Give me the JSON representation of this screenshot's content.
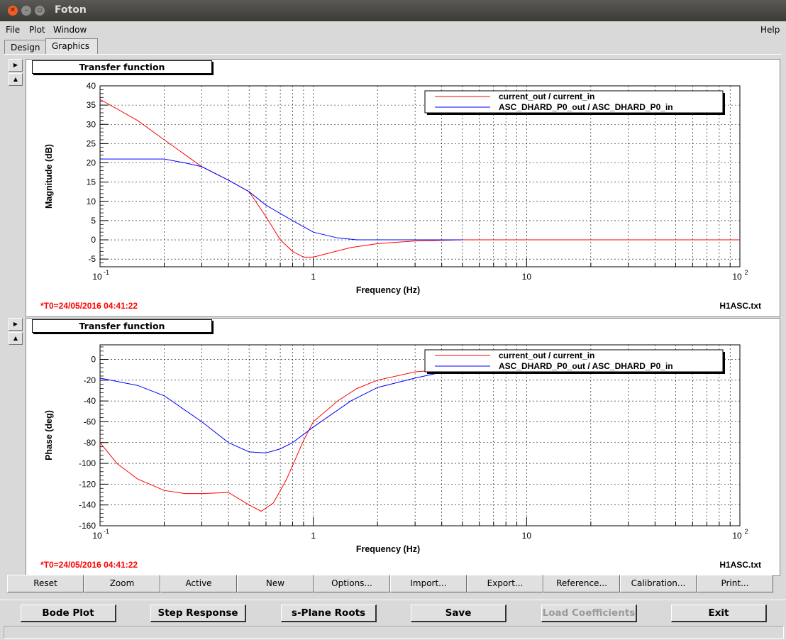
{
  "window": {
    "title": "Foton"
  },
  "menu": {
    "file": "File",
    "plot": "Plot",
    "window": "Window",
    "help": "Help"
  },
  "tabs": [
    {
      "label": "Design"
    },
    {
      "label": "Graphics"
    }
  ],
  "plots": [
    {
      "title": "Transfer function",
      "ylabel": "Magnitude (dB)",
      "xlabel": "Frequency (Hz)",
      "timestamp": "*T0=24/05/2016 04:41:22",
      "filename": "H1ASC.txt",
      "legend": [
        "current_out / current_in",
        "ASC_DHARD_P0_out / ASC_DHARD_P0_in"
      ]
    },
    {
      "title": "Transfer function",
      "ylabel": "Phase (deg)",
      "xlabel": "Frequency (Hz)",
      "timestamp": "*T0=24/05/2016 04:41:22",
      "filename": "H1ASC.txt",
      "legend": [
        "current_out / current_in",
        "ASC_DHARD_P0_out / ASC_DHARD_P0_in"
      ]
    }
  ],
  "chart_data": [
    {
      "type": "line",
      "title": "Transfer function",
      "xlabel": "Frequency (Hz)",
      "ylabel": "Magnitude (dB)",
      "xscale": "log",
      "xlim": [
        0.1,
        100
      ],
      "ylim": [
        -7,
        40
      ],
      "xticklabels": [
        "10^-1",
        "1",
        "10",
        "10^2"
      ],
      "yticks": [
        -5,
        0,
        5,
        10,
        15,
        20,
        25,
        30,
        35,
        40
      ],
      "grid": true,
      "legend_position": "top-right",
      "series": [
        {
          "name": "current_out / current_in",
          "color": "#ff0000",
          "x": [
            0.1,
            0.15,
            0.2,
            0.3,
            0.4,
            0.5,
            0.6,
            0.7,
            0.8,
            0.9,
            1.0,
            1.5,
            2,
            3,
            5,
            10,
            100
          ],
          "y": [
            36.5,
            31,
            26,
            19,
            15.5,
            12.5,
            6,
            0,
            -3,
            -4.5,
            -4.5,
            -2,
            -1,
            -0.3,
            0,
            0,
            0
          ]
        },
        {
          "name": "ASC_DHARD_P0_out / ASC_DHARD_P0_in",
          "color": "#0000ff",
          "x": [
            0.1,
            0.15,
            0.2,
            0.25,
            0.3,
            0.4,
            0.5,
            0.6,
            0.8,
            1.0,
            1.3,
            1.6,
            2,
            3,
            5
          ],
          "y": [
            21,
            21,
            21,
            20,
            19,
            15.5,
            12.5,
            9,
            5,
            2,
            0.5,
            0,
            0,
            0,
            0
          ]
        }
      ]
    },
    {
      "type": "line",
      "title": "Transfer function",
      "xlabel": "Frequency (Hz)",
      "ylabel": "Phase (deg)",
      "xscale": "log",
      "xlim": [
        0.1,
        100
      ],
      "ylim": [
        -160,
        14
      ],
      "xticklabels": [
        "10^-1",
        "1",
        "10",
        "10^2"
      ],
      "yticks": [
        -160,
        -140,
        -120,
        -100,
        -80,
        -60,
        -40,
        -20,
        0
      ],
      "grid": true,
      "legend_position": "top-right",
      "series": [
        {
          "name": "current_out / current_in",
          "color": "#ff0000",
          "x": [
            0.1,
            0.12,
            0.15,
            0.2,
            0.25,
            0.3,
            0.4,
            0.5,
            0.57,
            0.65,
            0.75,
            0.9,
            1.0,
            1.3,
            1.6,
            2,
            3,
            4
          ],
          "y": [
            -80,
            -100,
            -115,
            -126,
            -129,
            -129,
            -128,
            -140,
            -146,
            -138,
            -115,
            -78,
            -60,
            -40,
            -28,
            -20,
            -12,
            -10
          ]
        },
        {
          "name": "ASC_DHARD_P0_out / ASC_DHARD_P0_in",
          "color": "#0000ff",
          "x": [
            0.1,
            0.15,
            0.2,
            0.3,
            0.4,
            0.5,
            0.6,
            0.7,
            0.8,
            1.0,
            1.5,
            2,
            3,
            5
          ],
          "y": [
            -18,
            -25,
            -35,
            -60,
            -80,
            -89,
            -90,
            -86,
            -80,
            -65,
            -40,
            -27,
            -18,
            -8
          ]
        }
      ]
    }
  ],
  "buttons_top": [
    "Reset",
    "Zoom",
    "Active",
    "New",
    "Options...",
    "Import...",
    "Export...",
    "Reference...",
    "Calibration...",
    "Print..."
  ],
  "buttons_bottom": [
    {
      "label": "Bode Plot",
      "enabled": true
    },
    {
      "label": "Step Response",
      "enabled": true
    },
    {
      "label": "s-Plane Roots",
      "enabled": true
    },
    {
      "label": "Save",
      "enabled": true
    },
    {
      "label": "Load Coefficients",
      "enabled": false
    },
    {
      "label": "Exit",
      "enabled": true
    }
  ]
}
